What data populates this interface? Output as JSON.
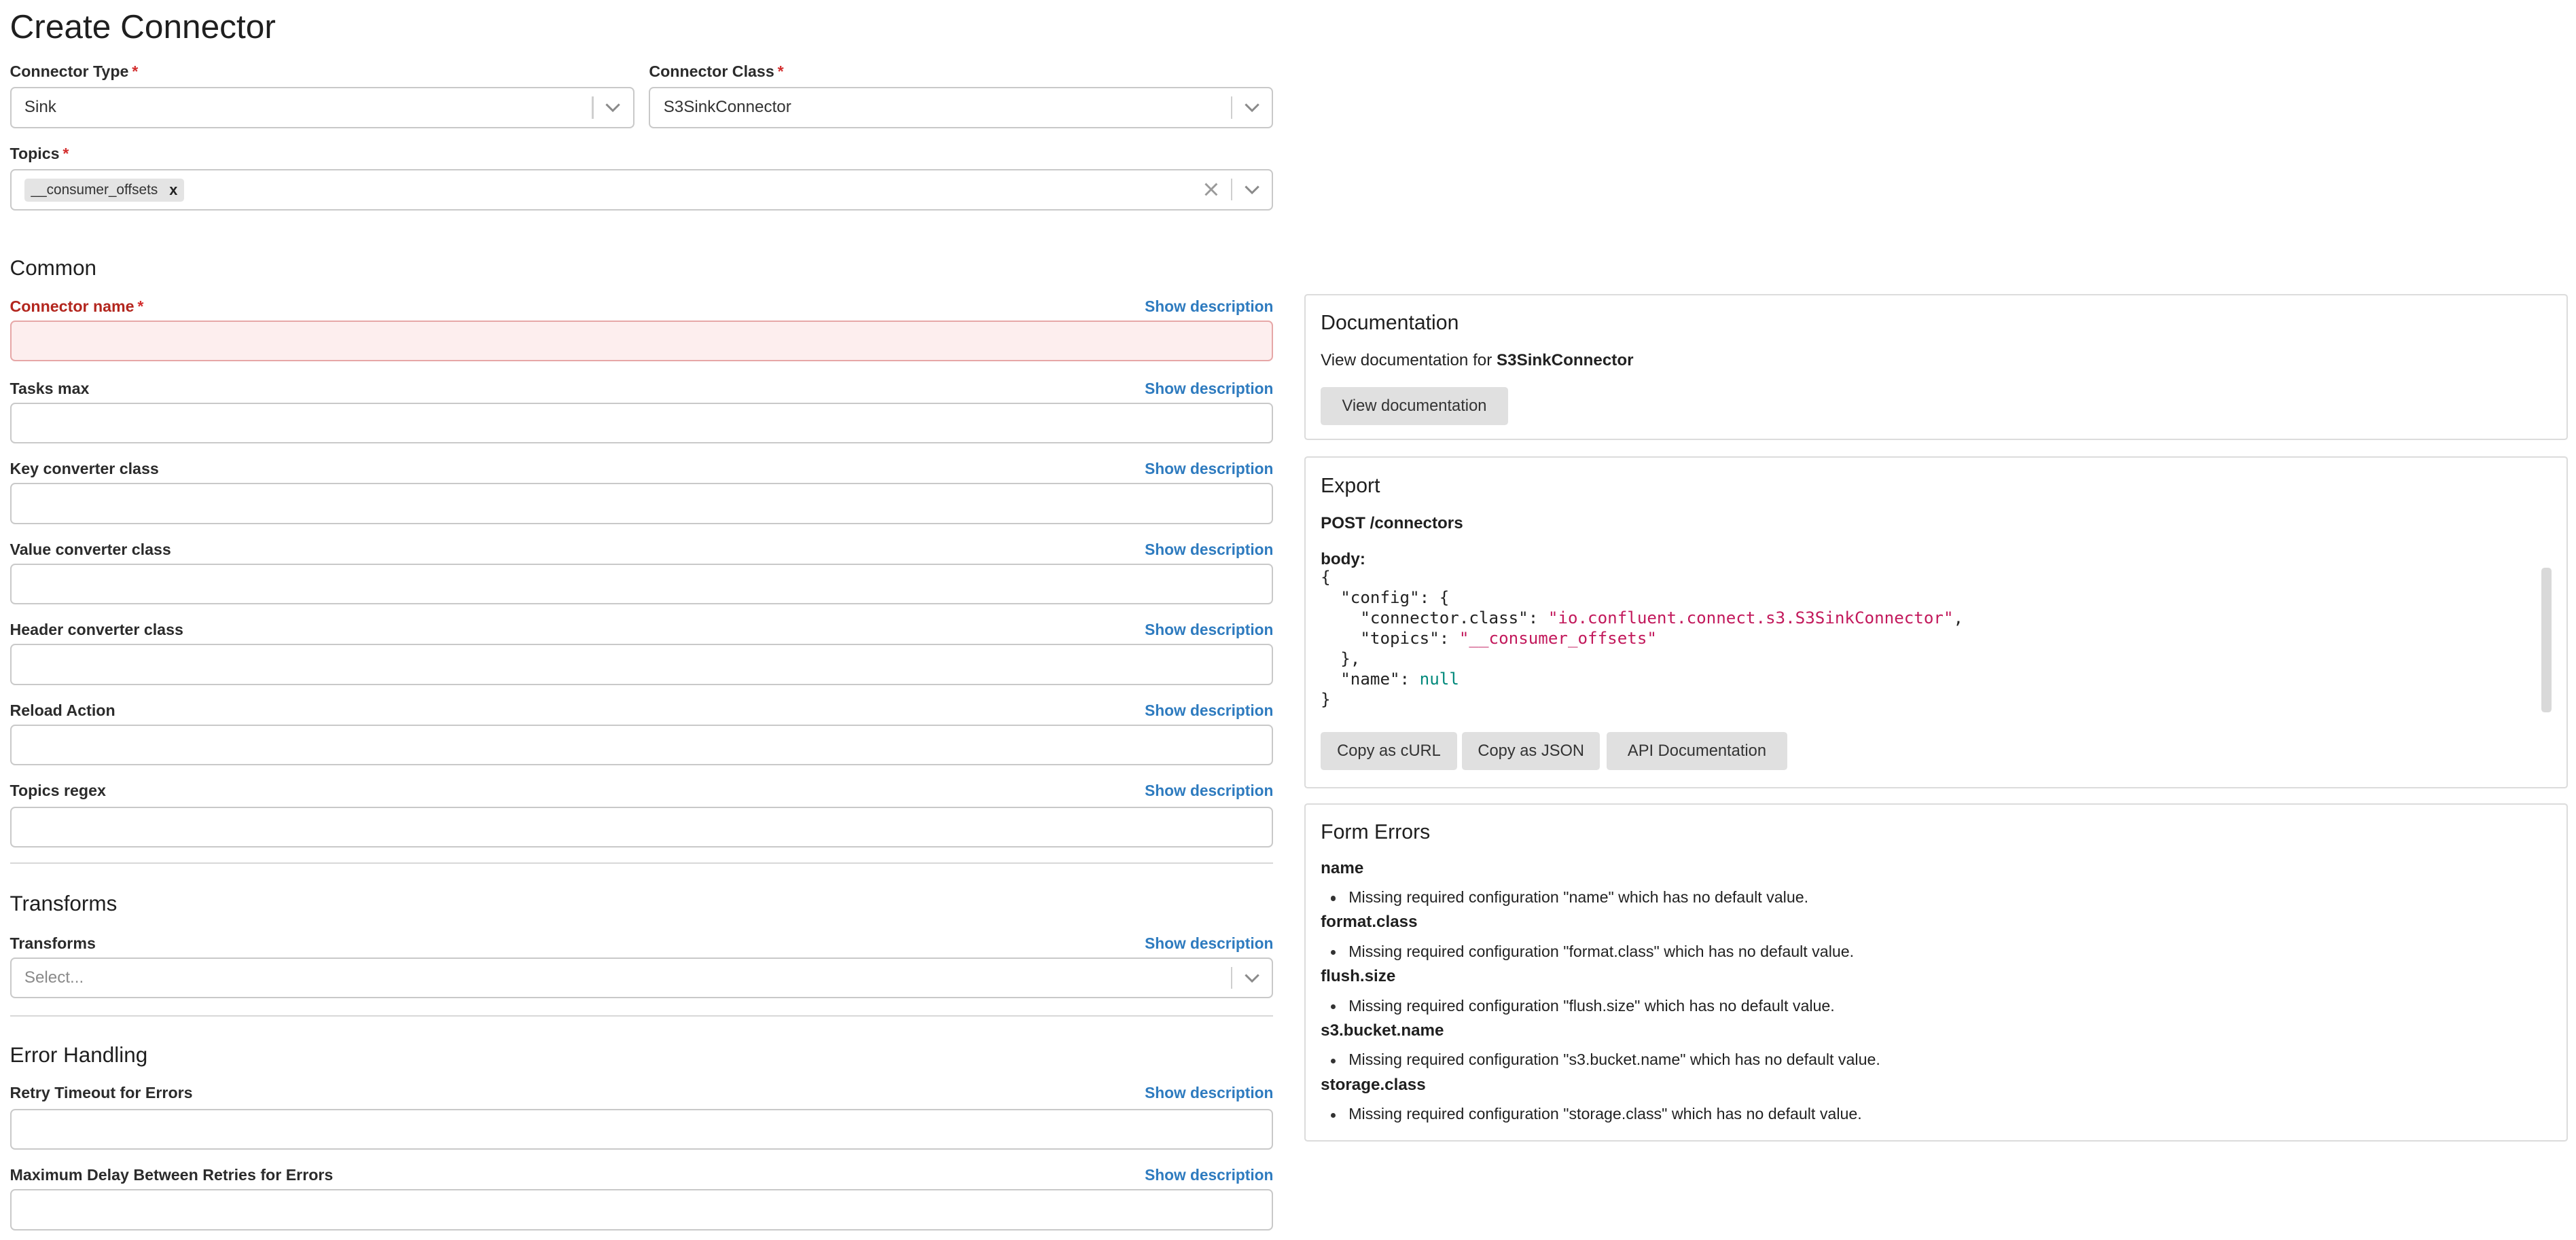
{
  "page": {
    "title": "Create Connector"
  },
  "top_fields": {
    "connector_type": {
      "label": "Connector Type",
      "value": "Sink"
    },
    "connector_class": {
      "label": "Connector Class",
      "value": "S3SinkConnector"
    },
    "topics": {
      "label": "Topics",
      "chip": "__consumer_offsets",
      "chip_remove": "x"
    }
  },
  "common": {
    "title": "Common",
    "show_description": "Show description",
    "fields": [
      {
        "label": "Connector name",
        "required": true,
        "value": ""
      },
      {
        "label": "Tasks max",
        "value": ""
      },
      {
        "label": "Key converter class",
        "value": ""
      },
      {
        "label": "Value converter class",
        "value": ""
      },
      {
        "label": "Header converter class",
        "value": ""
      },
      {
        "label": "Reload Action",
        "value": ""
      },
      {
        "label": "Topics regex",
        "value": ""
      }
    ]
  },
  "transforms": {
    "title": "Transforms",
    "field_label": "Transforms",
    "placeholder": "Select...",
    "show_description": "Show description"
  },
  "error_handling": {
    "title": "Error Handling",
    "show_description": "Show description",
    "fields": [
      {
        "label": "Retry Timeout for Errors",
        "value": ""
      },
      {
        "label": "Maximum Delay Between Retries for Errors",
        "value": ""
      }
    ]
  },
  "documentation": {
    "title": "Documentation",
    "text_prefix": "View documentation for",
    "connector": "S3SinkConnector",
    "button": "View documentation"
  },
  "export": {
    "title": "Export",
    "endpoint": "POST /connectors",
    "body_label": "body:",
    "code": {
      "l1": "{",
      "l2_key": "  \"config\": {",
      "l3_key": "    \"connector.class\": ",
      "l3_val": "\"io.confluent.connect.s3.S3SinkConnector\"",
      "l3_end": ",",
      "l4_key": "    \"topics\": ",
      "l4_val": "\"__consumer_offsets\"",
      "l5": "  },",
      "l6_key": "  \"name\": ",
      "l6_val": "null",
      "l7": "}"
    },
    "buttons": [
      "Copy as cURL",
      "Copy as JSON",
      "API Documentation"
    ]
  },
  "form_errors": {
    "title": "Form Errors",
    "items": [
      {
        "field": "name",
        "message": "Missing required configuration \"name\" which has no default value."
      },
      {
        "field": "format.class",
        "message": "Missing required configuration \"format.class\" which has no default value."
      },
      {
        "field": "flush.size",
        "message": "Missing required configuration \"flush.size\" which has no default value."
      },
      {
        "field": "s3.bucket.name",
        "message": "Missing required configuration \"s3.bucket.name\" which has no default value."
      },
      {
        "field": "storage.class",
        "message": "Missing required configuration \"storage.class\" which has no default value."
      }
    ]
  },
  "colors": {
    "link": "#2e7bbf",
    "required": "#d32f2f",
    "error_field_bg": "#fdeeee",
    "string": "#c2185b",
    "keyword": "#00897b"
  },
  "icons": {
    "chevron": "chevron-down-icon",
    "clear": "clear-icon",
    "remove": "close-icon"
  }
}
